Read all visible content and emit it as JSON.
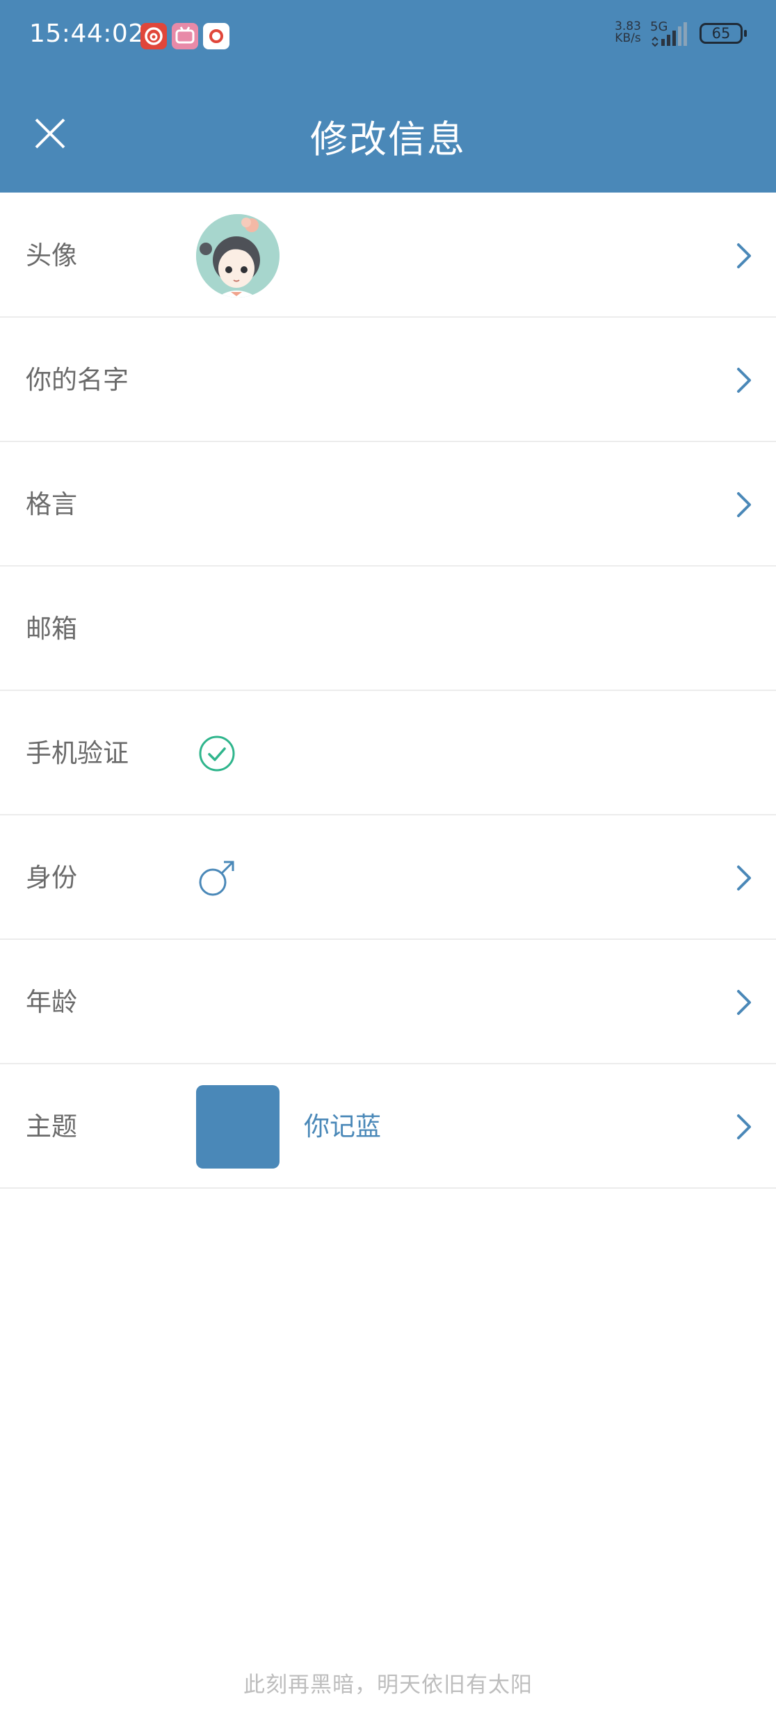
{
  "status_bar": {
    "time": "15:44:02",
    "net_speed_value": "3.83",
    "net_speed_unit": "KB/s",
    "network": "5G",
    "battery": "65",
    "notifications": [
      "netease-music-icon",
      "bilibili-icon",
      "weibo-icon"
    ]
  },
  "app_bar": {
    "close_icon": "close-icon",
    "title": "修改信息"
  },
  "rows": [
    {
      "label": "头像",
      "has_chevron": true,
      "value_type": "avatar"
    },
    {
      "label": "你的名字",
      "has_chevron": true,
      "value_type": "empty"
    },
    {
      "label": "格言",
      "has_chevron": true,
      "value_type": "empty"
    },
    {
      "label": "邮箱",
      "has_chevron": false,
      "value_type": "empty"
    },
    {
      "label": "手机验证",
      "has_chevron": false,
      "value_type": "verified-check-icon"
    },
    {
      "label": "身份",
      "has_chevron": true,
      "value_type": "male-icon"
    },
    {
      "label": "年龄",
      "has_chevron": true,
      "value_type": "empty"
    },
    {
      "label": "主题",
      "has_chevron": true,
      "value_type": "theme",
      "theme_name": "你记蓝"
    }
  ],
  "footer": {
    "quote": "此刻再黑暗，明天依旧有太阳"
  },
  "colors": {
    "primary": "#4a88b8",
    "check_green": "#2fb58c",
    "label_gray": "#6a6a6a",
    "divider": "#ececec",
    "footer_gray": "#bdbdbd"
  }
}
